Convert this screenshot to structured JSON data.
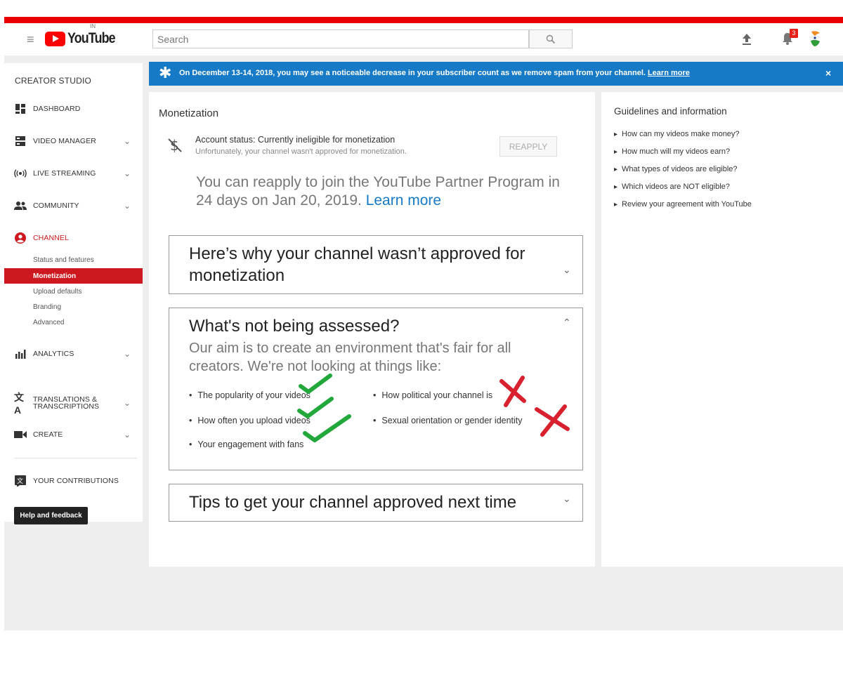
{
  "header": {
    "logo_text": "YouTube",
    "logo_country": "IN",
    "search_placeholder": "Search",
    "notification_count": "3"
  },
  "sidebar": {
    "title": "CREATOR STUDIO",
    "items": [
      {
        "label": "DASHBOARD",
        "icon": "dashboard-icon"
      },
      {
        "label": "VIDEO MANAGER",
        "icon": "video-manager-icon"
      },
      {
        "label": "LIVE STREAMING",
        "icon": "live-streaming-icon"
      },
      {
        "label": "COMMUNITY",
        "icon": "community-icon"
      },
      {
        "label": "CHANNEL",
        "icon": "channel-icon"
      },
      {
        "label": "ANALYTICS",
        "icon": "analytics-icon"
      },
      {
        "label": "TRANSLATIONS &",
        "label2": "TRANSCRIPTIONS",
        "icon": "translate-icon"
      },
      {
        "label": "CREATE",
        "icon": "create-icon"
      },
      {
        "label": "YOUR CONTRIBUTIONS",
        "icon": "contributions-icon"
      }
    ],
    "channel_subitems": [
      "Status and features",
      "Monetization",
      "Upload defaults",
      "Branding",
      "Advanced"
    ],
    "help_label": "Help and feedback"
  },
  "banner": {
    "text": "On December 13-14, 2018, you may see a noticeable decrease in your subscriber count as we remove spam from your channel.",
    "link": "Learn more",
    "close": "×"
  },
  "main": {
    "title": "Monetization",
    "status_title": "Account status: Currently ineligible for monetization",
    "status_sub": "Unfortunately, your channel wasn't approved for monetization.",
    "reapply_label": "REAPPLY",
    "reapply_msg": "You can reapply to join the YouTube Partner Program in 24 days on Jan 20, 2019.",
    "reapply_link": "Learn more",
    "sections": [
      {
        "line1": "Here’s why your channel wasn’t approved for",
        "line2": "monetization"
      },
      {
        "title": "What's not being assessed?",
        "desc": "Our aim is to create an environment that's fair for all creators. We're not looking at things like:"
      },
      {
        "title": "Tips to get your channel approved next time"
      }
    ],
    "bullets_left": [
      "The popularity of your videos",
      "How often you upload videos",
      "Your engagement with fans"
    ],
    "bullets_right": [
      "How political your channel is",
      "Sexual orientation or gender identity"
    ]
  },
  "guidelines": {
    "title": "Guidelines and information",
    "items": [
      "How can my videos make money?",
      "How much will my videos earn?",
      "What types of videos are eligible?",
      "Which videos are NOT eligible?",
      "Review your agreement with YouTube"
    ]
  },
  "colors": {
    "accent_red": "#cc181e",
    "banner_blue": "#167ac6",
    "check_green": "#22a83a",
    "cross_red": "#d8202e"
  }
}
